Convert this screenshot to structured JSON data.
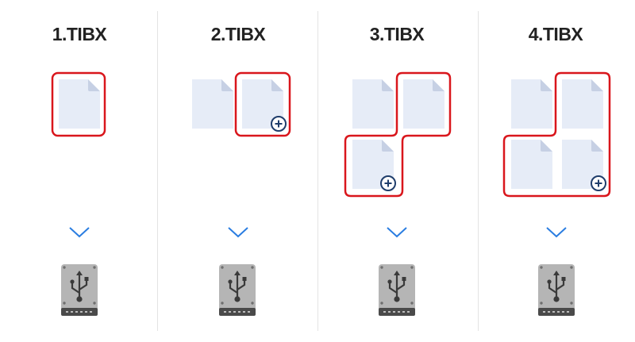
{
  "columns": [
    {
      "title": "1.TIBX",
      "files": 1,
      "new_file": false
    },
    {
      "title": "2.TIBX",
      "files": 2,
      "new_file": true
    },
    {
      "title": "3.TIBX",
      "files": 3,
      "new_file": true
    },
    {
      "title": "4.TIBX",
      "files": 4,
      "new_file": true
    }
  ],
  "colors": {
    "highlight_border": "#d9161c",
    "file_fill": "#e6ecf7",
    "file_fold": "#c6d0e4",
    "arrow": "#2a7de1",
    "plus_badge": "#1f3d6b",
    "drive_body": "#b5b5b5",
    "drive_base": "#4a4a4a",
    "divider": "#e3e3e3"
  },
  "icons": {
    "file": "document-icon",
    "add": "plus-circle-icon",
    "arrow": "chevron-down-icon",
    "drive": "usb-drive-icon"
  }
}
